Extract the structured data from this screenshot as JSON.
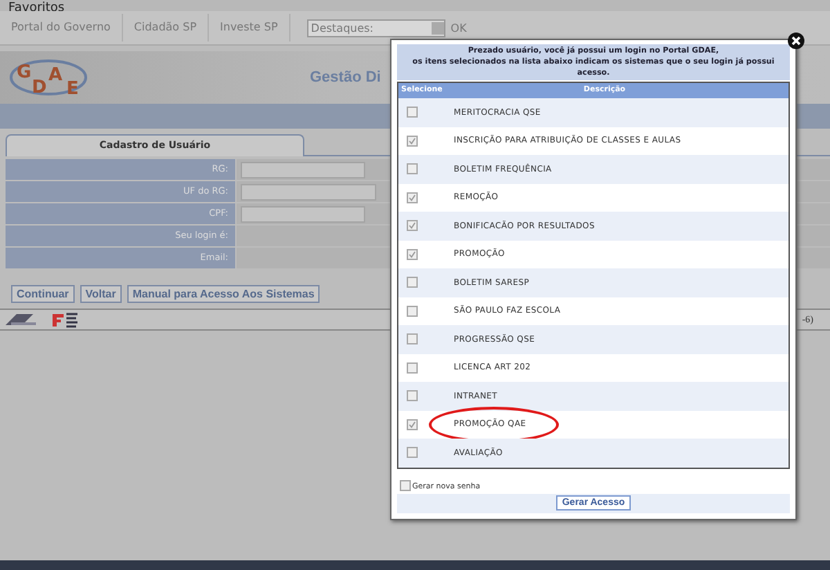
{
  "browser_bar": {
    "items": [
      "Favoritos"
    ]
  },
  "nav": {
    "links": [
      "Portal do Governo",
      "Cidadão SP",
      "Investe SP"
    ],
    "select": {
      "value": "Destaques:"
    },
    "ok": "OK"
  },
  "header": {
    "logo": "GDAE",
    "title": "Gestão Di"
  },
  "form": {
    "tab": "Cadastro de Usuário",
    "fields": [
      {
        "label": "RG:",
        "kind": "input"
      },
      {
        "label": "UF do RG:",
        "kind": "select"
      },
      {
        "label": "CPF:",
        "kind": "input"
      },
      {
        "label": "Seu login é:",
        "kind": "text"
      },
      {
        "label": "Email:",
        "kind": "text"
      }
    ],
    "buttons": [
      "Continuar",
      "Voltar",
      "Manual para Acesso Aos Sistemas"
    ],
    "side_text": "-6)"
  },
  "dialog": {
    "message": [
      "Prezado usuário, você já possui um login no Portal GDAE,",
      "os itens selecionados na lista abaixo indicam os sistemas que o seu login já possui acesso."
    ],
    "columns": [
      "Selecione",
      "Descrição"
    ],
    "rows": [
      {
        "label": "MERITOCRACIA QSE",
        "checked": false,
        "highlighted": false
      },
      {
        "label": "INSCRIÇÃO PARA ATRIBUIÇÃO DE CLASSES E AULAS",
        "checked": true,
        "highlighted": false
      },
      {
        "label": "BOLETIM FREQUÊNCIA",
        "checked": false,
        "highlighted": false
      },
      {
        "label": "REMOÇÃO",
        "checked": true,
        "highlighted": false
      },
      {
        "label": "BONIFICACÃO POR RESULTADOS",
        "checked": true,
        "highlighted": false
      },
      {
        "label": "PROMOÇÃO",
        "checked": true,
        "highlighted": false
      },
      {
        "label": "BOLETIM SARESP",
        "checked": false,
        "highlighted": false
      },
      {
        "label": "SÃO PAULO FAZ ESCOLA",
        "checked": false,
        "highlighted": false
      },
      {
        "label": "PROGRESSÃO QSE",
        "checked": false,
        "highlighted": false
      },
      {
        "label": "LICENCA ART 202",
        "checked": false,
        "highlighted": false
      },
      {
        "label": "INTRANET",
        "checked": false,
        "highlighted": false
      },
      {
        "label": "PROMOÇÃO QAE",
        "checked": true,
        "highlighted": true
      },
      {
        "label": "AVALIAÇÃO",
        "checked": false,
        "highlighted": false
      }
    ],
    "new_password": {
      "label": "Gerar nova senha",
      "checked": false
    },
    "submit": "Gerar Acesso"
  }
}
